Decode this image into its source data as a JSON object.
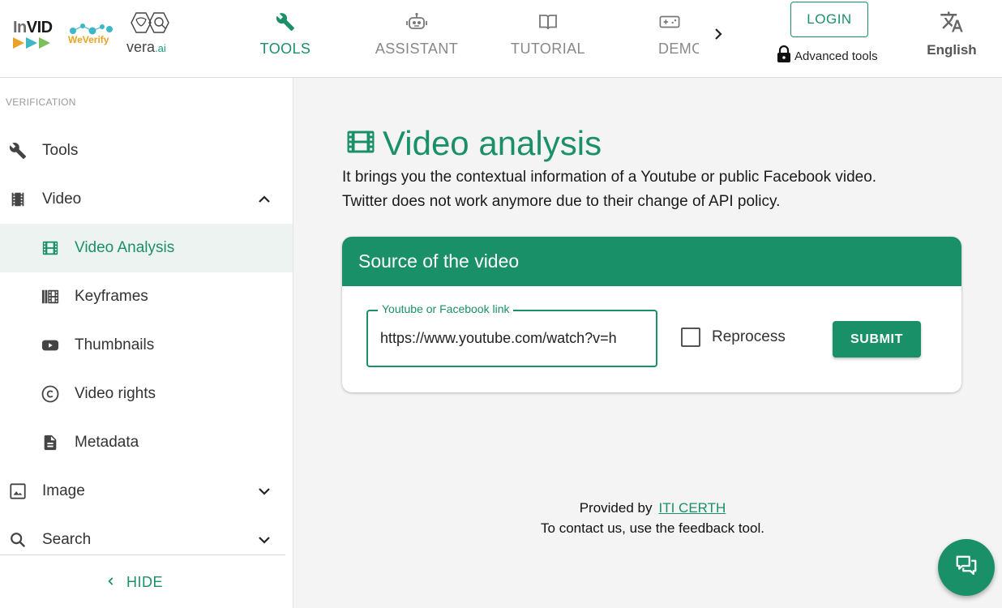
{
  "colors": {
    "accent": "#1a9068",
    "nav_inactive": "#888888",
    "selected_bg": "#edf3f1"
  },
  "logos": {
    "invid": {
      "part1": "In",
      "part2": "VID"
    },
    "weverify": {
      "text": "WeVerify"
    },
    "veraai": {
      "text": "vera",
      "suffix": ".ai"
    }
  },
  "nav": {
    "tabs": [
      {
        "label": "TOOLS",
        "icon": "wrench-icon",
        "active": true
      },
      {
        "label": "ASSISTANT",
        "icon": "robot-icon",
        "active": false
      },
      {
        "label": "TUTORIAL",
        "icon": "book-icon",
        "active": false
      },
      {
        "label": "DEMO",
        "icon": "gamepad-icon",
        "active": false
      }
    ],
    "login_label": "LOGIN",
    "advanced_tools_label": "Advanced tools",
    "language_label": "English"
  },
  "sidebar": {
    "section_label": "VERIFICATION",
    "items": [
      {
        "label": "Tools",
        "icon": "wrench-icon"
      },
      {
        "label": "Video",
        "icon": "film-icon",
        "expanded": true
      },
      {
        "label": "Video Analysis",
        "icon": "movie-icon",
        "selected": true
      },
      {
        "label": "Keyframes",
        "icon": "filmstrip-icon"
      },
      {
        "label": "Thumbnails",
        "icon": "youtube-icon"
      },
      {
        "label": "Video rights",
        "icon": "copyright-icon"
      },
      {
        "label": "Metadata",
        "icon": "document-icon"
      },
      {
        "label": "Image",
        "icon": "image-icon",
        "expanded": false
      },
      {
        "label": "Search",
        "icon": "search-icon",
        "expanded": false
      }
    ],
    "hide_label": "HIDE"
  },
  "main": {
    "title": "Video analysis",
    "description_line1": "It brings you the contextual information of a Youtube or public Facebook video.",
    "description_line2": "Twitter does not work anymore due to their change of API policy.",
    "card": {
      "header": "Source of the video",
      "url_label": "Youtube or Facebook link",
      "url_value": "https://www.youtube.com/watch?v=h",
      "reprocess_label": "Reprocess",
      "reprocess_checked": false,
      "submit_label": "SUBMIT"
    },
    "footer": {
      "provided_by": "Provided by",
      "provider_link": "ITI CERTH",
      "contact_text": "To contact us, use the feedback tool."
    }
  }
}
